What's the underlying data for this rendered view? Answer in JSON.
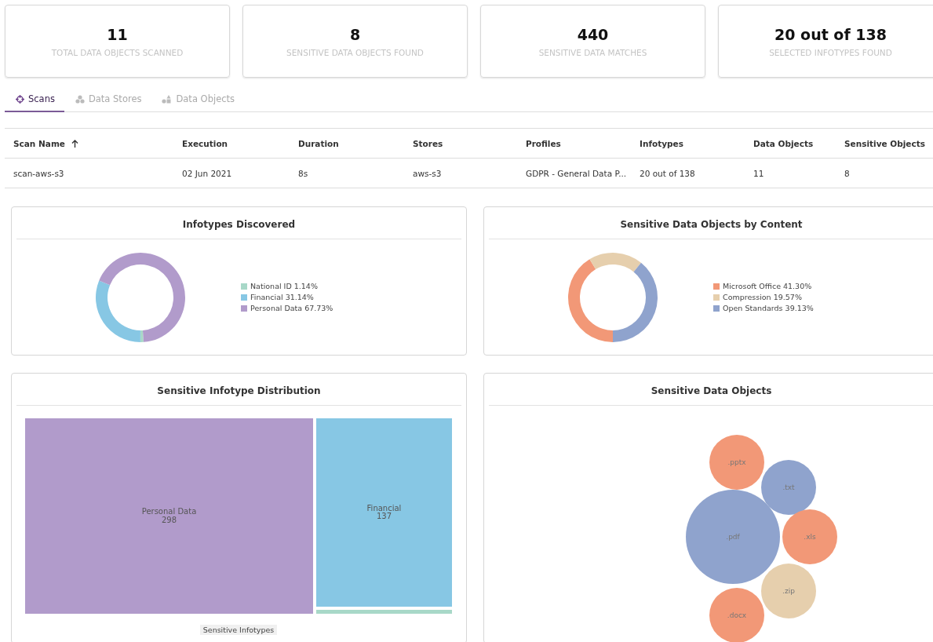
{
  "stats": [
    {
      "value": "11",
      "label": "TOTAL DATA OBJECTS SCANNED"
    },
    {
      "value": "8",
      "label": "SENSITIVE DATA OBJECTS FOUND"
    },
    {
      "value": "440",
      "label": "SENSITIVE DATA MATCHES"
    },
    {
      "value": "20 out of 138",
      "label": "SELECTED INFOTYPES FOUND"
    }
  ],
  "tabs": [
    {
      "label": "Scans",
      "kind": "crosshair",
      "selected": true
    },
    {
      "label": "Data Stores",
      "kind": "stores",
      "selected": false
    },
    {
      "label": "Data Objects",
      "kind": "objects",
      "selected": false
    }
  ],
  "table": {
    "columns": [
      {
        "label": "Scan Name",
        "sorted": true
      },
      {
        "label": "Execution",
        "sorted": false
      },
      {
        "label": "Duration",
        "sorted": false
      },
      {
        "label": "Stores",
        "sorted": false
      },
      {
        "label": "Profiles",
        "sorted": false
      },
      {
        "label": "Infotypes",
        "sorted": false
      },
      {
        "label": "Data Objects",
        "sorted": false
      },
      {
        "label": "Sensitive Objects",
        "sorted": false
      }
    ],
    "rows": [
      [
        "scan-aws-s3",
        "02 Jun 2021",
        "8s",
        "aws-s3",
        "GDPR - General Data P...",
        "20 out of 138",
        "11",
        "8"
      ]
    ]
  },
  "donuts": [
    {
      "title": "Infotypes Discovered",
      "legend": [
        {
          "share": "1.14%",
          "color": "#a8d8c8"
        },
        {
          "share": "31.14%",
          "color": "#87c7e4"
        },
        {
          "share": "67.73%",
          "color": "#b19bcb"
        }
      ],
      "chart_data": {
        "type": "donut",
        "categories": [
          "National ID",
          "Financial",
          "Personal Data"
        ],
        "values": [
          1.14,
          31.14,
          67.73
        ]
      }
    },
    {
      "title": "Sensitive Data Objects by Content",
      "legend": [
        {
          "share": "41.30%",
          "color": "#f29877"
        },
        {
          "share": "19.57%",
          "color": "#e6cfad"
        },
        {
          "share": "39.13%",
          "color": "#8fa3cd"
        }
      ],
      "chart_data": {
        "type": "donut",
        "categories": [
          "Microsoft Office",
          "Compression",
          "Open Standards"
        ],
        "values": [
          41.3,
          19.57,
          39.13
        ]
      }
    }
  ],
  "treemap": {
    "title": "Sensitive Infotype Distribution",
    "axis_label": "Sensitive Infotypes",
    "cells": [
      {
        "name": "Personal Data",
        "value": "298",
        "color": "#b19bcb"
      },
      {
        "name": "Financial",
        "value": "137",
        "color": "#87c7e4"
      },
      {
        "color": "#a8d8c8"
      }
    ]
  },
  "bubbles": {
    "title": "Sensitive Data Objects",
    "items": [
      {
        "label": ".pptx",
        "color": "#f29877"
      },
      {
        "label": ".txt",
        "color": "#8fa3cd"
      },
      {
        "label": ".pdf",
        "color": "#8fa3cd"
      },
      {
        "label": ".xls",
        "color": "#f29877"
      },
      {
        "label": ".zip",
        "color": "#e6cfad"
      },
      {
        "label": ".docx",
        "color": "#f29877"
      }
    ]
  }
}
